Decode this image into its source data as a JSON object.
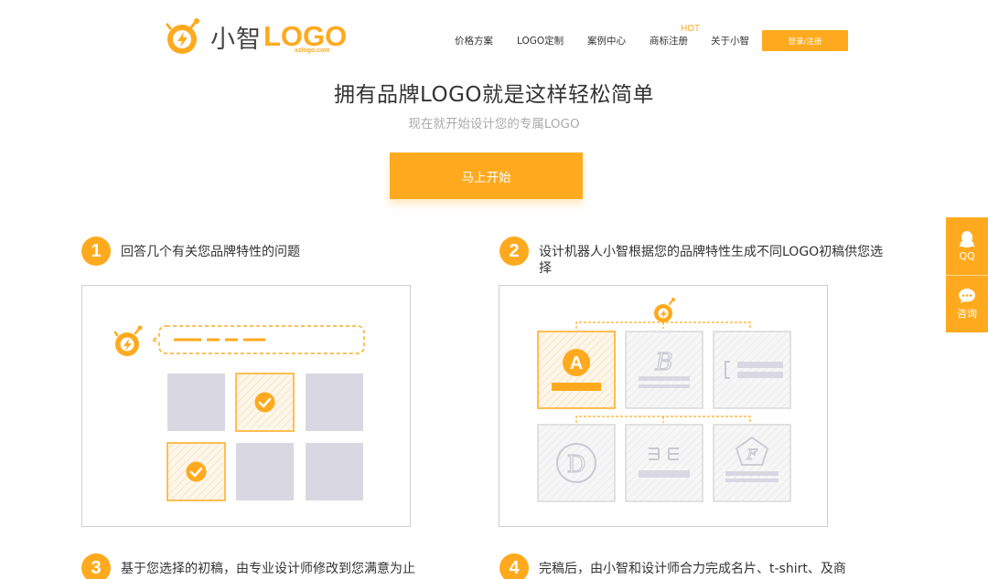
{
  "header": {
    "logo_cn": "小智",
    "logo_en": "LOGO",
    "logo_sub": "xzlogo.com",
    "nav": [
      {
        "label": "价格方案"
      },
      {
        "label": "LOGO定制"
      },
      {
        "label": "案例中心"
      },
      {
        "label": "商标注册"
      },
      {
        "label": "关于小智"
      }
    ],
    "hot_badge": "HOT",
    "login_label": "登录/注册"
  },
  "hero": {
    "title": "拥有品牌LOGO就是这样轻松简单",
    "subtitle": "现在就开始设计您的专属LOGO",
    "cta_label": "马上开始"
  },
  "steps": [
    {
      "num": "1",
      "text": "回答几个有关您品牌特性的问题"
    },
    {
      "num": "2",
      "text": "设计机器人小智根据您的品牌特性生成不同LOGO初稿供您选择"
    },
    {
      "num": "3",
      "text": "基于您选择的初稿，由专业设计师修改到您满意为止"
    },
    {
      "num": "4",
      "text": "完稿后，由小智和设计师合力完成名片、t-shirt、及商"
    }
  ],
  "illustration2": {
    "letters": [
      "A",
      "B",
      "D",
      "F"
    ]
  },
  "side_widget": {
    "qq_label": "QQ",
    "consult_label": "咨询"
  },
  "colors": {
    "accent": "#ffaa1e",
    "tile_gray": "#d9d8e2",
    "text": "#333333",
    "muted": "#aaaaaa"
  }
}
